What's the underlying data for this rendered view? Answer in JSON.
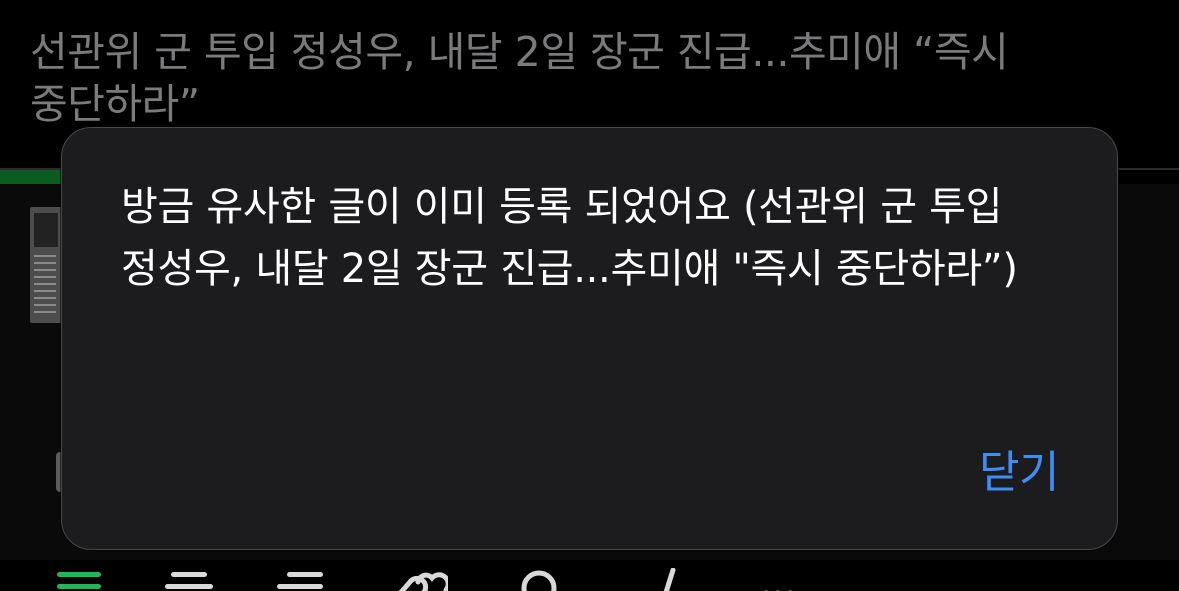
{
  "background": {
    "post_title": "선관위 군 투입 정성우, 내달 2일 장군 진급...추미애 “즉시 중단하라”"
  },
  "toolbar": {
    "items": [
      {
        "name": "list-icon"
      },
      {
        "name": "align-center-icon"
      },
      {
        "name": "align-right-icon"
      },
      {
        "name": "link-icon"
      },
      {
        "name": "search-icon"
      },
      {
        "name": "code-icon"
      },
      {
        "name": "more-icon"
      }
    ]
  },
  "dialog": {
    "message": "방금 유사한 글이 이미 등록 되었어요 (선관위 군 투입 정성우, 내달 2일 장군 진급...추미애 \"즉시 중단하라”)",
    "close_label": "닫기"
  },
  "colors": {
    "accent_blue": "#3f8cf4",
    "accent_green": "#1db954",
    "dialog_bg": "#1c1c1e"
  }
}
